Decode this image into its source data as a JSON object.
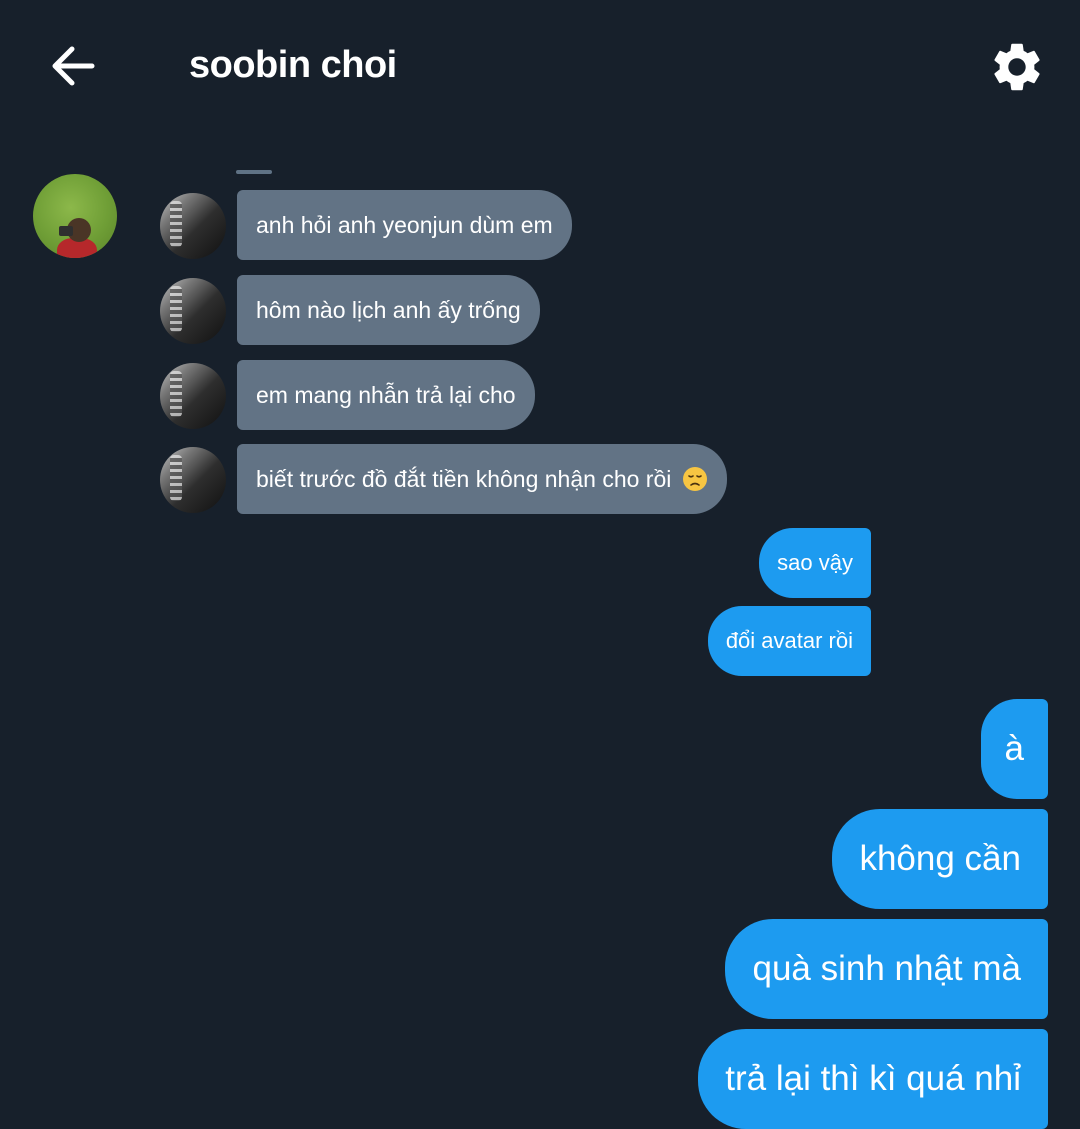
{
  "header": {
    "back_icon": "arrow-left-icon",
    "title": "soobin choi",
    "settings_icon": "gear-icon"
  },
  "colors": {
    "background": "#17202b",
    "incoming_bubble": "#627385",
    "outgoing_bubble": "#1d9bf0",
    "text": "#ffffff"
  },
  "messages": {
    "incoming": [
      "anh hỏi anh yeonjun dùm em",
      "hôm nào lịch anh ấy trống",
      "em mang nhẫn trả lại cho",
      "biết trước đồ đắt tiền không nhận cho rồi"
    ],
    "incoming_emoji": "disappointed-face-emoji",
    "outgoing_small": [
      "sao vậy",
      "đổi avatar rồi"
    ],
    "outgoing_large": [
      "à",
      "không cần",
      "quà sinh nhật mà",
      "trả lại thì kì quá nhỉ"
    ]
  }
}
